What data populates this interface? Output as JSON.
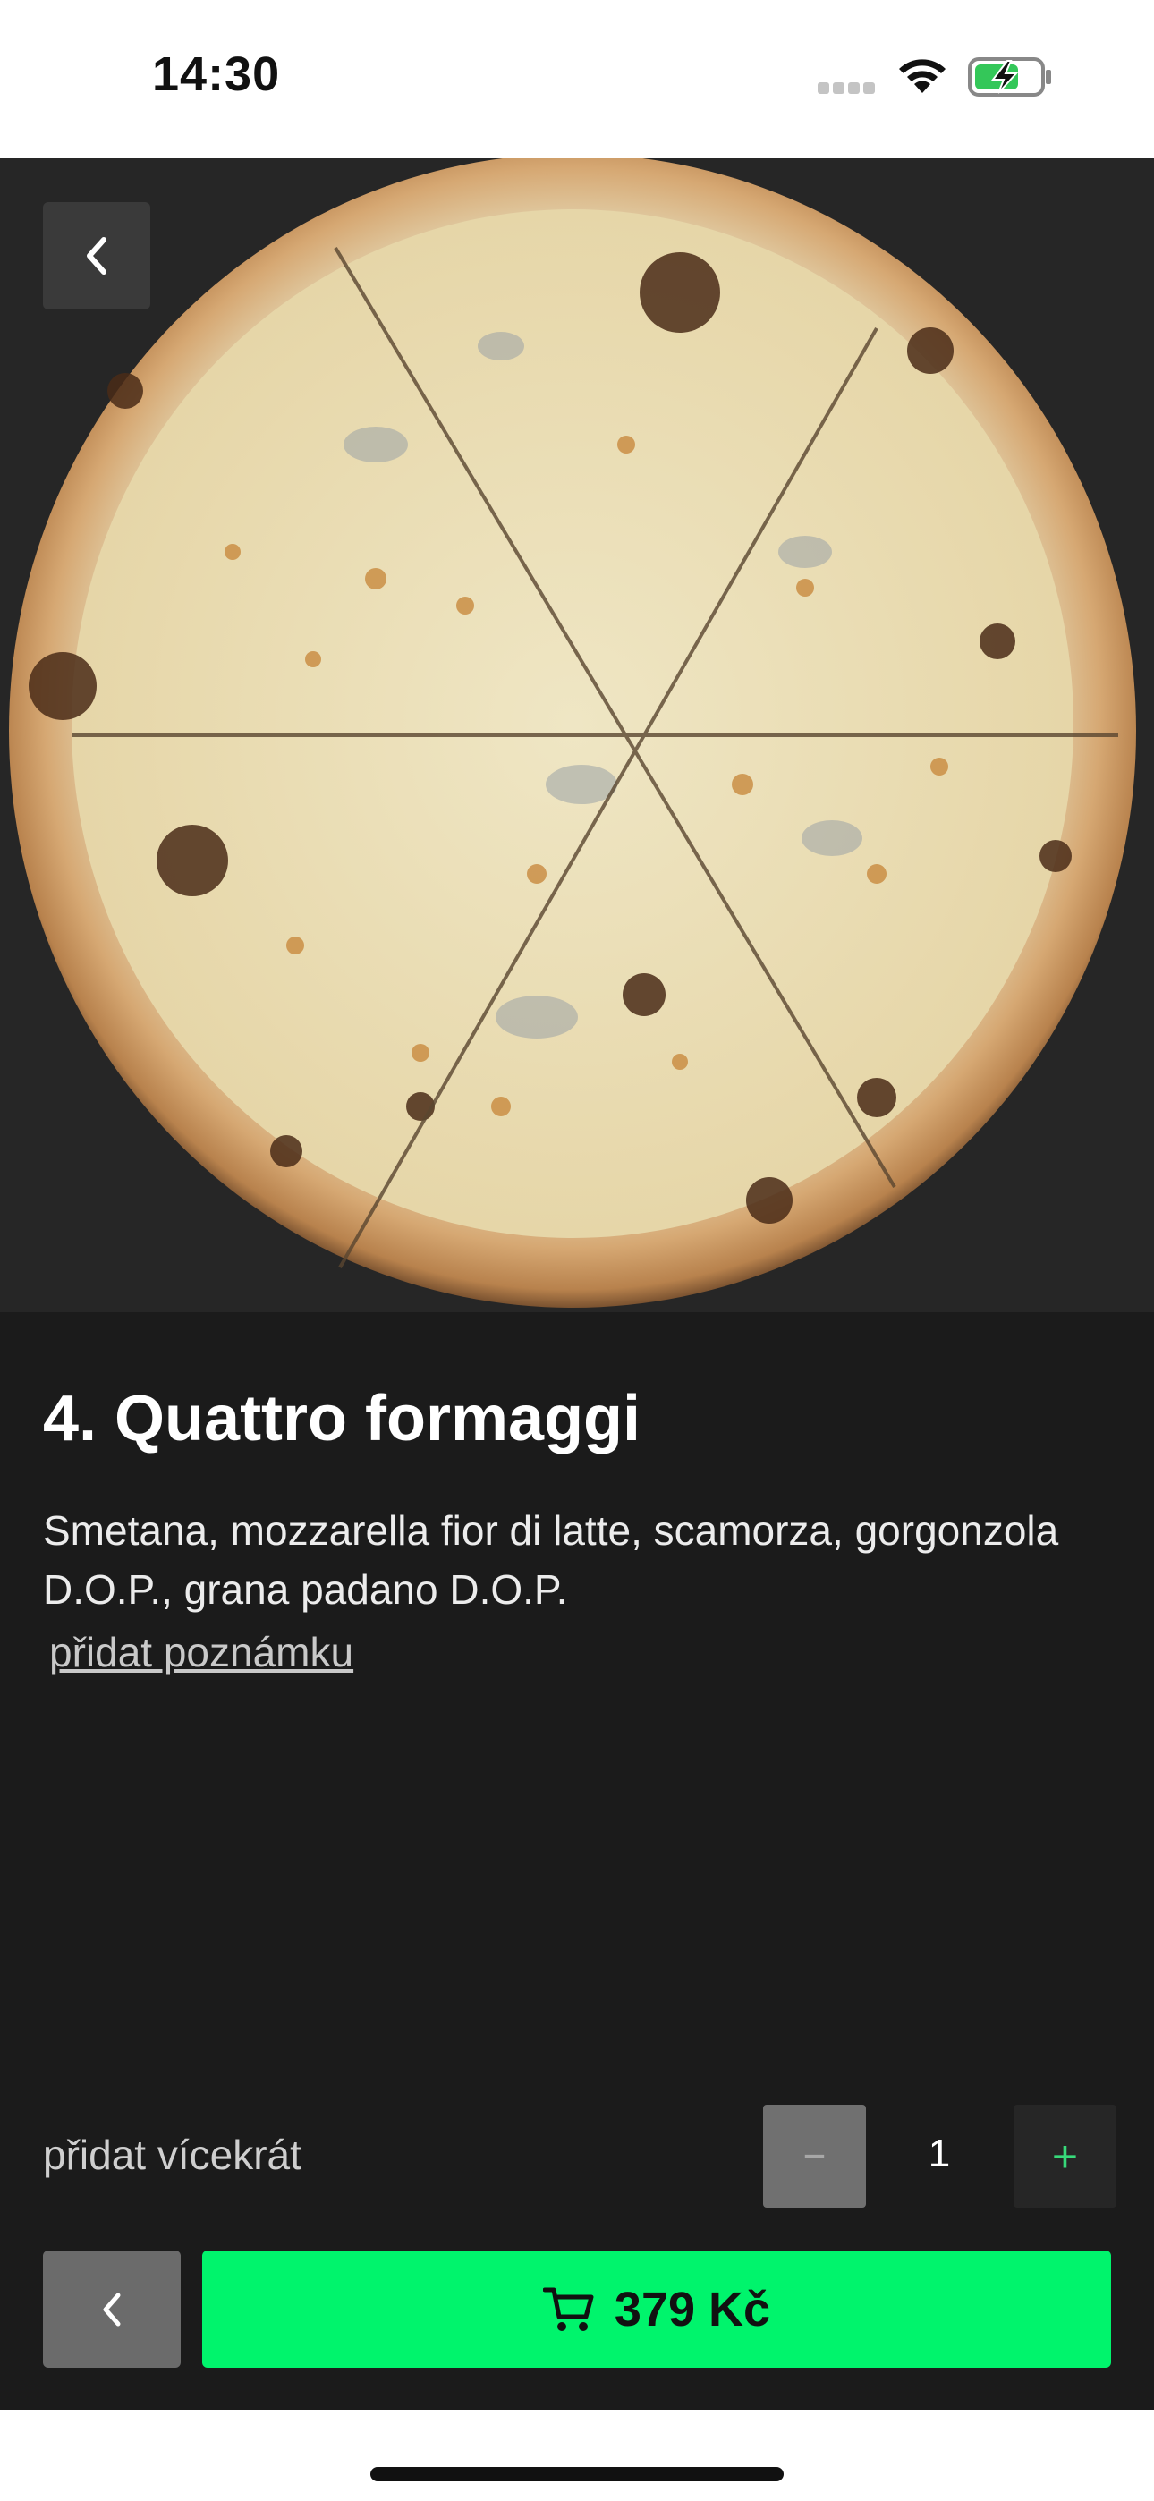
{
  "status_bar": {
    "time": "14:30"
  },
  "product": {
    "title": "4. Quattro formaggi",
    "description": "Smetana, mozzarella fior di latte, scamorza, gorgonzola D.O.P., grana padano D.O.P.",
    "add_note_label": "přidat poznámku",
    "image_icon": "pizza-photo"
  },
  "quantity": {
    "label": "přidat vícekrát",
    "value": "1",
    "minus_symbol": "−",
    "plus_symbol": "+"
  },
  "cart": {
    "price_label": "379 Kč",
    "icon": "cart-icon"
  },
  "colors": {
    "accent_green": "#00f46c",
    "background": "#1b1b1b",
    "hero_background": "#262626"
  }
}
